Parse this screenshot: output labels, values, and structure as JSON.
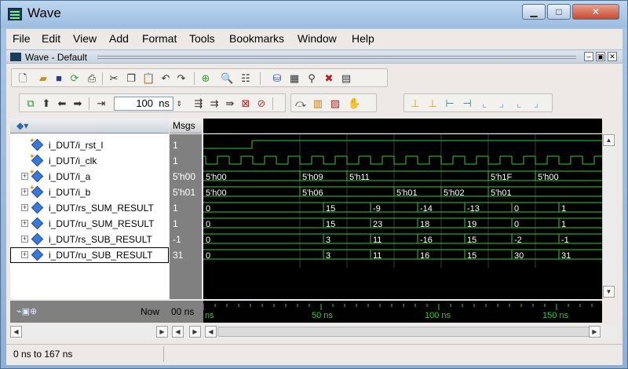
{
  "window": {
    "title": "Wave"
  },
  "menu": [
    "File",
    "Edit",
    "View",
    "Add",
    "Format",
    "Tools",
    "Bookmarks",
    "Window",
    "Help"
  ],
  "subwindow": {
    "title": "Wave - Default"
  },
  "toolbar": {
    "zoom_value": "100",
    "zoom_unit": "ns"
  },
  "columns": {
    "msgs": "Msgs"
  },
  "signals": [
    {
      "name": "i_DUT/i_rst_l",
      "value": "1",
      "expandable": false,
      "kind": "bit"
    },
    {
      "name": "i_DUT/i_clk",
      "value": "1",
      "expandable": false,
      "kind": "bit"
    },
    {
      "name": "i_DUT/i_a",
      "value": "5'h00",
      "expandable": true,
      "kind": "bus"
    },
    {
      "name": "i_DUT/i_b",
      "value": "5'h01",
      "expandable": true,
      "kind": "bus"
    },
    {
      "name": "i_DUT/rs_SUM_RESULT",
      "value": "1",
      "expandable": true,
      "kind": "bus"
    },
    {
      "name": "i_DUT/ru_SUM_RESULT",
      "value": "1",
      "expandable": true,
      "kind": "bus"
    },
    {
      "name": "i_DUT/rs_SUB_RESULT",
      "value": "-1",
      "expandable": true,
      "kind": "bus"
    },
    {
      "name": "i_DUT/ru_SUB_RESULT",
      "value": "31",
      "expandable": true,
      "kind": "bus"
    }
  ],
  "bus_segments": [
    [
      "5'h00",
      "5'h09",
      "5'h11",
      "5'h1F",
      "5'h00"
    ],
    [
      "5'h00",
      "5'h06",
      "5'h01",
      "5'h02",
      "5'h01"
    ],
    [
      "0",
      "15",
      "-9",
      "-14",
      "-13",
      "0",
      "1"
    ],
    [
      "0",
      "15",
      "23",
      "18",
      "19",
      "0",
      "1"
    ],
    [
      "0",
      "3",
      "11",
      "-16",
      "15",
      "-2",
      "-1"
    ],
    [
      "0",
      "3",
      "11",
      "16",
      "15",
      "30",
      "31"
    ]
  ],
  "cursor": {
    "label": "Now",
    "value": "00 ns"
  },
  "timeline_labels": [
    "ns",
    "50 ns",
    "100 ns",
    "150 ns"
  ],
  "status": {
    "range": "0 ns to 167 ns"
  },
  "colors": {
    "wave": "#2bd12b",
    "background": "#000000",
    "text": "#ffffff"
  }
}
